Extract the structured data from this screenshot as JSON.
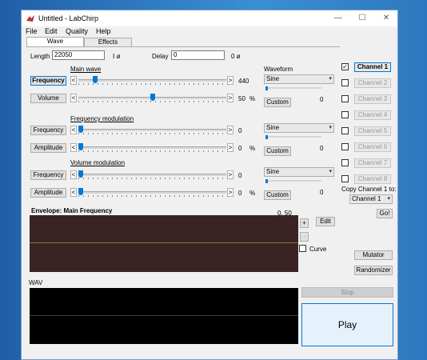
{
  "window": {
    "title": "Untitled - LabChirp",
    "minimize": "—",
    "maximize": "☐",
    "close": "✕"
  },
  "menu": [
    "File",
    "Edit",
    "Quality",
    "Help"
  ],
  "tabs": [
    "Wave",
    "Effects"
  ],
  "length": {
    "label": "Length",
    "value": "22050",
    "unit": "Ⅰ ø"
  },
  "delay": {
    "label": "Delay",
    "value": "0",
    "unit": "0 ø"
  },
  "sections": {
    "main_wave": "Main wave",
    "frequency_modulation": "Frequency modulation",
    "volume_modulation": "Volume modulation",
    "waveform": "Waveform"
  },
  "rows": [
    {
      "label": "Frequency",
      "value": "440",
      "unit": "",
      "level": 0.1
    },
    {
      "label": "Volume",
      "value": "50",
      "unit": "%",
      "level": 0.5
    },
    {
      "label": "Frequency",
      "value": "0",
      "unit": "",
      "level": 0
    },
    {
      "label": "Amplitude",
      "value": "0",
      "unit": "%",
      "level": 0
    },
    {
      "label": "Frequency",
      "value": "0",
      "unit": "",
      "level": 0
    },
    {
      "label": "Amplitude",
      "value": "0",
      "unit": "%",
      "level": 0
    }
  ],
  "waveforms": [
    {
      "selected": "Sine",
      "custom": "Custom",
      "value": "0"
    },
    {
      "selected": "Sine",
      "custom": "Custom",
      "value": "0"
    },
    {
      "selected": "Sine",
      "custom": "Custom",
      "value": "0"
    }
  ],
  "arrows": {
    "left": "<",
    "right": ">"
  },
  "envelope": {
    "title": "Envelope: Main Frequency",
    "readout": "0, 50",
    "plus": "+",
    "minus": "-",
    "edit": "Edit",
    "curve": "Curve"
  },
  "channels": [
    "Channel 1",
    "Channel 2",
    "Channel 3",
    "Channel 4",
    "Channel 5",
    "Channel 6",
    "Channel 7",
    "Channel 8"
  ],
  "copy": {
    "label": "Copy Channel 1 to:",
    "selected": "Channel 1",
    "go": "Go!"
  },
  "mutator": "Mutator",
  "randomizer": "Randomizer",
  "wav_label": "WAV",
  "stop": "Stop",
  "play": "Play",
  "check_mark": "✓"
}
